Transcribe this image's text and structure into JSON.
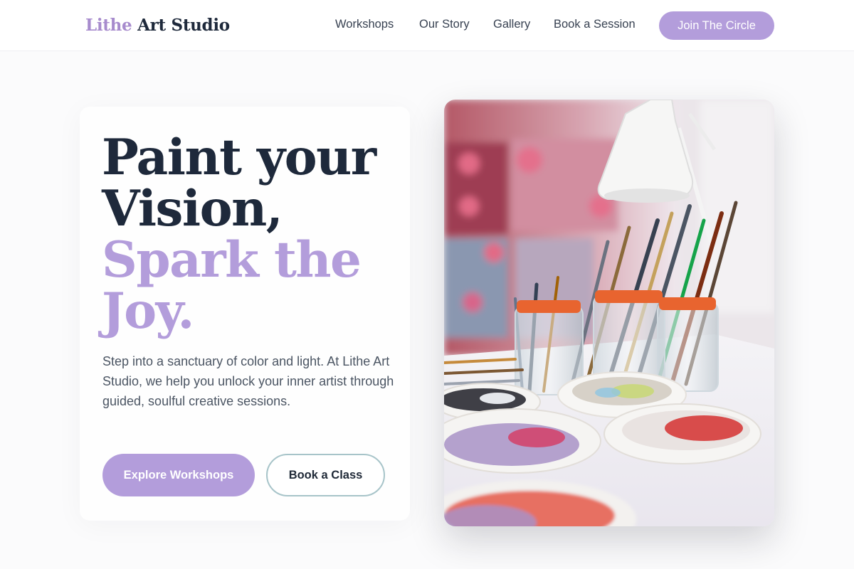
{
  "header": {
    "logo": {
      "accent": "Lithe",
      "rest": "Art Studio"
    },
    "nav": [
      "Workshops",
      "Our Story",
      "Gallery",
      "Book a Session"
    ],
    "cta": "Join The Circle"
  },
  "hero": {
    "headline": [
      "Paint your",
      "Vision,",
      "Spark the",
      "Joy."
    ],
    "description": "Step into a sanctuary of color and light. At Lithe Art Studio, we help you unlock your inner artist through guided, soulful creative sessions.",
    "primary_button": "Explore Workshops",
    "secondary_button": "Book a Class"
  },
  "colors": {
    "accent": "#b39ddb",
    "dark": "#1e293b",
    "outline": "#a7c4c9"
  }
}
